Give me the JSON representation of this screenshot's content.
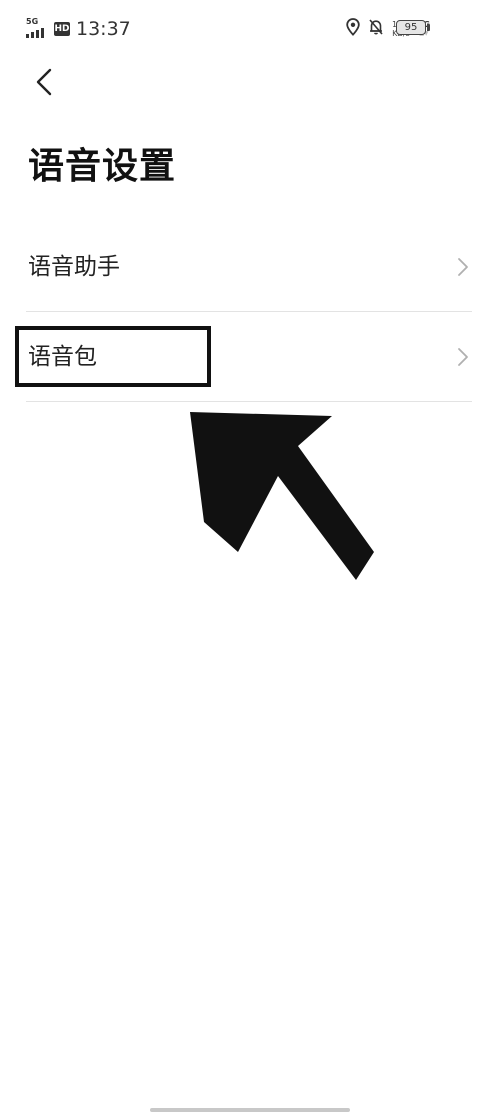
{
  "status_bar": {
    "signal_label": "5G",
    "hd_label": "HD",
    "time": "13:37",
    "net_speed_value": "11.3",
    "net_speed_unit": "KB/s",
    "network_label": "5G",
    "battery_level": "95",
    "icons": [
      "location-icon",
      "bell-muted-icon"
    ]
  },
  "header": {
    "back_icon": "chevron-left-icon"
  },
  "page": {
    "title": "语音设置"
  },
  "settings": {
    "items": [
      {
        "label": "语音助手",
        "icon": "chevron-right-icon"
      },
      {
        "label": "语音包",
        "icon": "chevron-right-icon"
      }
    ]
  },
  "annotation": {
    "highlighted_item": "语音包",
    "arrow_icon": "pointer-arrow-icon",
    "color": "#111111"
  },
  "colors": {
    "background": "#ffffff",
    "text_primary": "#111111",
    "divider": "#e3e3e3",
    "chevron": "#b0b0b0"
  }
}
